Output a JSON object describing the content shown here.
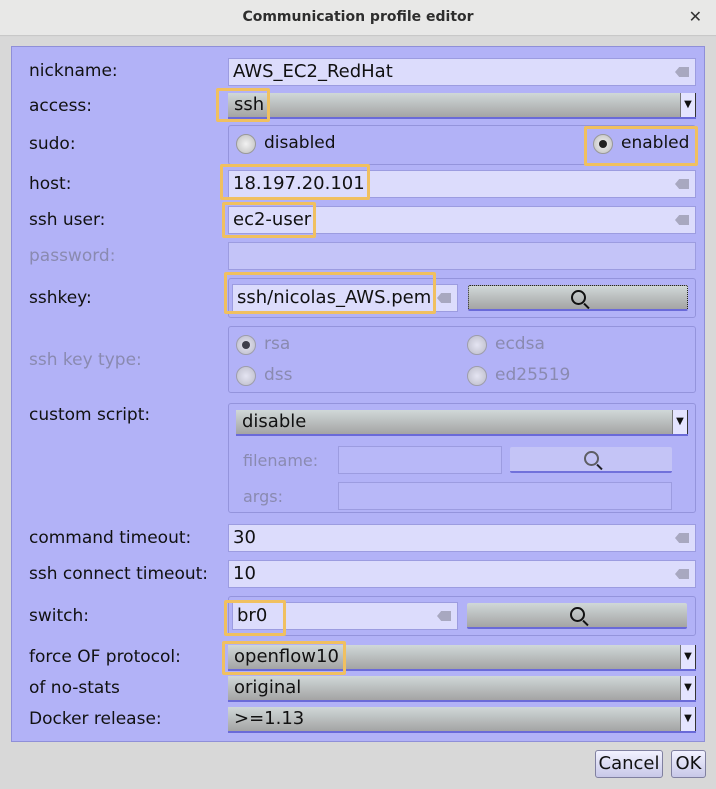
{
  "window": {
    "title": "Communication profile editor",
    "close": "✕"
  },
  "fields": {
    "nickname": {
      "label": "nickname:",
      "value": "AWS_EC2_RedHat"
    },
    "access": {
      "label": "access:",
      "value": "ssh"
    },
    "sudo": {
      "label": "sudo:",
      "options": [
        "disabled",
        "enabled"
      ],
      "selected": "enabled"
    },
    "host": {
      "label": "host:",
      "value": "18.197.20.101"
    },
    "ssh_user": {
      "label": "ssh user:",
      "value": "ec2-user"
    },
    "password": {
      "label": "password:",
      "value": ""
    },
    "sshkey": {
      "label": "sshkey:",
      "value": "ssh/nicolas_AWS.pem"
    },
    "ssh_key_type": {
      "label": "ssh key type:",
      "options": [
        "rsa",
        "ecdsa",
        "dss",
        "ed25519"
      ],
      "selected": "rsa"
    },
    "custom_script": {
      "label": "custom script:",
      "value": "disable",
      "filename_label": "filename:",
      "args_label": "args:"
    },
    "command_timeout": {
      "label": "command timeout:",
      "value": "30"
    },
    "ssh_connect_timeout": {
      "label": "ssh connect timeout:",
      "value": "10"
    },
    "switch": {
      "label": "switch:",
      "value": "br0"
    },
    "force_of_protocol": {
      "label": "force OF protocol:",
      "value": "openflow10"
    },
    "of_no_stats": {
      "label": "of no-stats",
      "value": "original"
    },
    "docker_release": {
      "label": "Docker release:",
      "value": ">=1.13"
    }
  },
  "buttons": {
    "cancel": "Cancel",
    "ok": "OK"
  }
}
